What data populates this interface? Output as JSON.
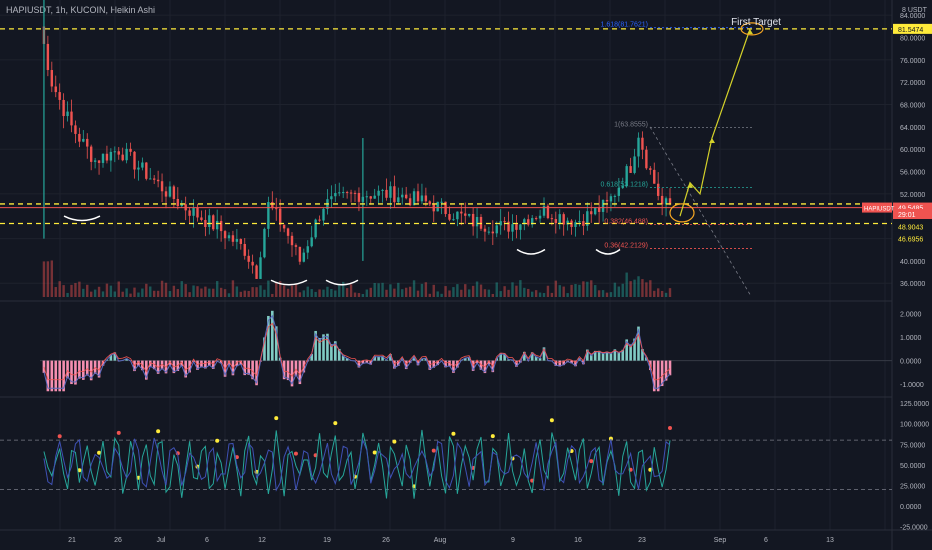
{
  "header": {
    "symbol_line": "HAPIUSDT, 1h, KUCOIN, Heikin Ashi"
  },
  "annotation": {
    "first_target": "First Target"
  },
  "price_axis": {
    "currency": "USDT",
    "top_label": "8",
    "ticks": [
      "84.0000",
      "80.0000",
      "76.0000",
      "72.0000",
      "68.0000",
      "64.0000",
      "60.0000",
      "56.0000",
      "52.0000",
      "44.0000",
      "40.0000",
      "36.0000"
    ],
    "badges": [
      {
        "text": "81.5474",
        "value": 81.5474,
        "color": "#ffeb3b",
        "text_color": "#131722"
      },
      {
        "text": "49.5622",
        "value": 49.5622,
        "color": "#131722",
        "text_color": "#ef5350"
      },
      {
        "text": "49.5485",
        "value": 49.5485,
        "color": "#ef5350",
        "text_color": "#ffffff"
      },
      {
        "text": "29:01",
        "value": 48.4,
        "color": "#ef5350",
        "text_color": "#ffffff"
      },
      {
        "text": "48.9043",
        "value": 46.2,
        "color": "#131722",
        "text_color": "#ffeb3b"
      },
      {
        "text": "46.6956",
        "value": 44.0,
        "color": "#131722",
        "text_color": "#ffeb3b"
      }
    ],
    "symbol_tag": "HAPIUSDT"
  },
  "macd_axis": {
    "ticks": [
      "2.0000",
      "1.0000",
      "0.0000",
      "-1.0000"
    ]
  },
  "rsi_axis": {
    "ticks": [
      "125.0000",
      "100.0000",
      "75.0000",
      "50.0000",
      "25.0000",
      "0.0000",
      "-25.0000"
    ]
  },
  "time_axis": {
    "labels": [
      "21",
      "26",
      "Jul",
      "6",
      "12",
      "19",
      "26",
      "Aug",
      "9",
      "16",
      "23",
      "Sep",
      "6",
      "13"
    ]
  },
  "fib_labels": {
    "f1618": "1.618(81.7621)",
    "f1": "1(63.8555)",
    "f0618": "0.618(53.1218)",
    "f0382": "0.382(46.488)",
    "f0": "0.36(42.2129)"
  },
  "colors": {
    "bull": "#26a69a",
    "bear": "#ef5350",
    "target": "#ffeb3b",
    "bg": "#131722",
    "grid": "#1e222d"
  },
  "chart_data": {
    "type": "candlestick",
    "title": "HAPIUSDT, 1h, KUCOIN, Heikin Ashi",
    "price_range": [
      33,
      86
    ],
    "key_levels": [
      81.5474,
      49.5485,
      48.9043,
      46.6956
    ],
    "first_target": 81.5474,
    "approx_path": [
      [
        0,
        82
      ],
      [
        3,
        72
      ],
      [
        8,
        64
      ],
      [
        14,
        58
      ],
      [
        20,
        60
      ],
      [
        28,
        55
      ],
      [
        36,
        50
      ],
      [
        45,
        46
      ],
      [
        52,
        42
      ],
      [
        55,
        38
      ],
      [
        58,
        50
      ],
      [
        62,
        46
      ],
      [
        66,
        40
      ],
      [
        72,
        50
      ],
      [
        80,
        52
      ],
      [
        90,
        52
      ],
      [
        100,
        50
      ],
      [
        110,
        47
      ],
      [
        118,
        46
      ],
      [
        128,
        49
      ],
      [
        136,
        47
      ],
      [
        144,
        50
      ],
      [
        150,
        57
      ],
      [
        152,
        63
      ],
      [
        154,
        58
      ],
      [
        158,
        50
      ]
    ],
    "macd_range": [
      -1.5,
      2.4
    ],
    "rsi_range": [
      -25,
      125
    ],
    "rsi_levels": [
      80,
      20
    ]
  }
}
